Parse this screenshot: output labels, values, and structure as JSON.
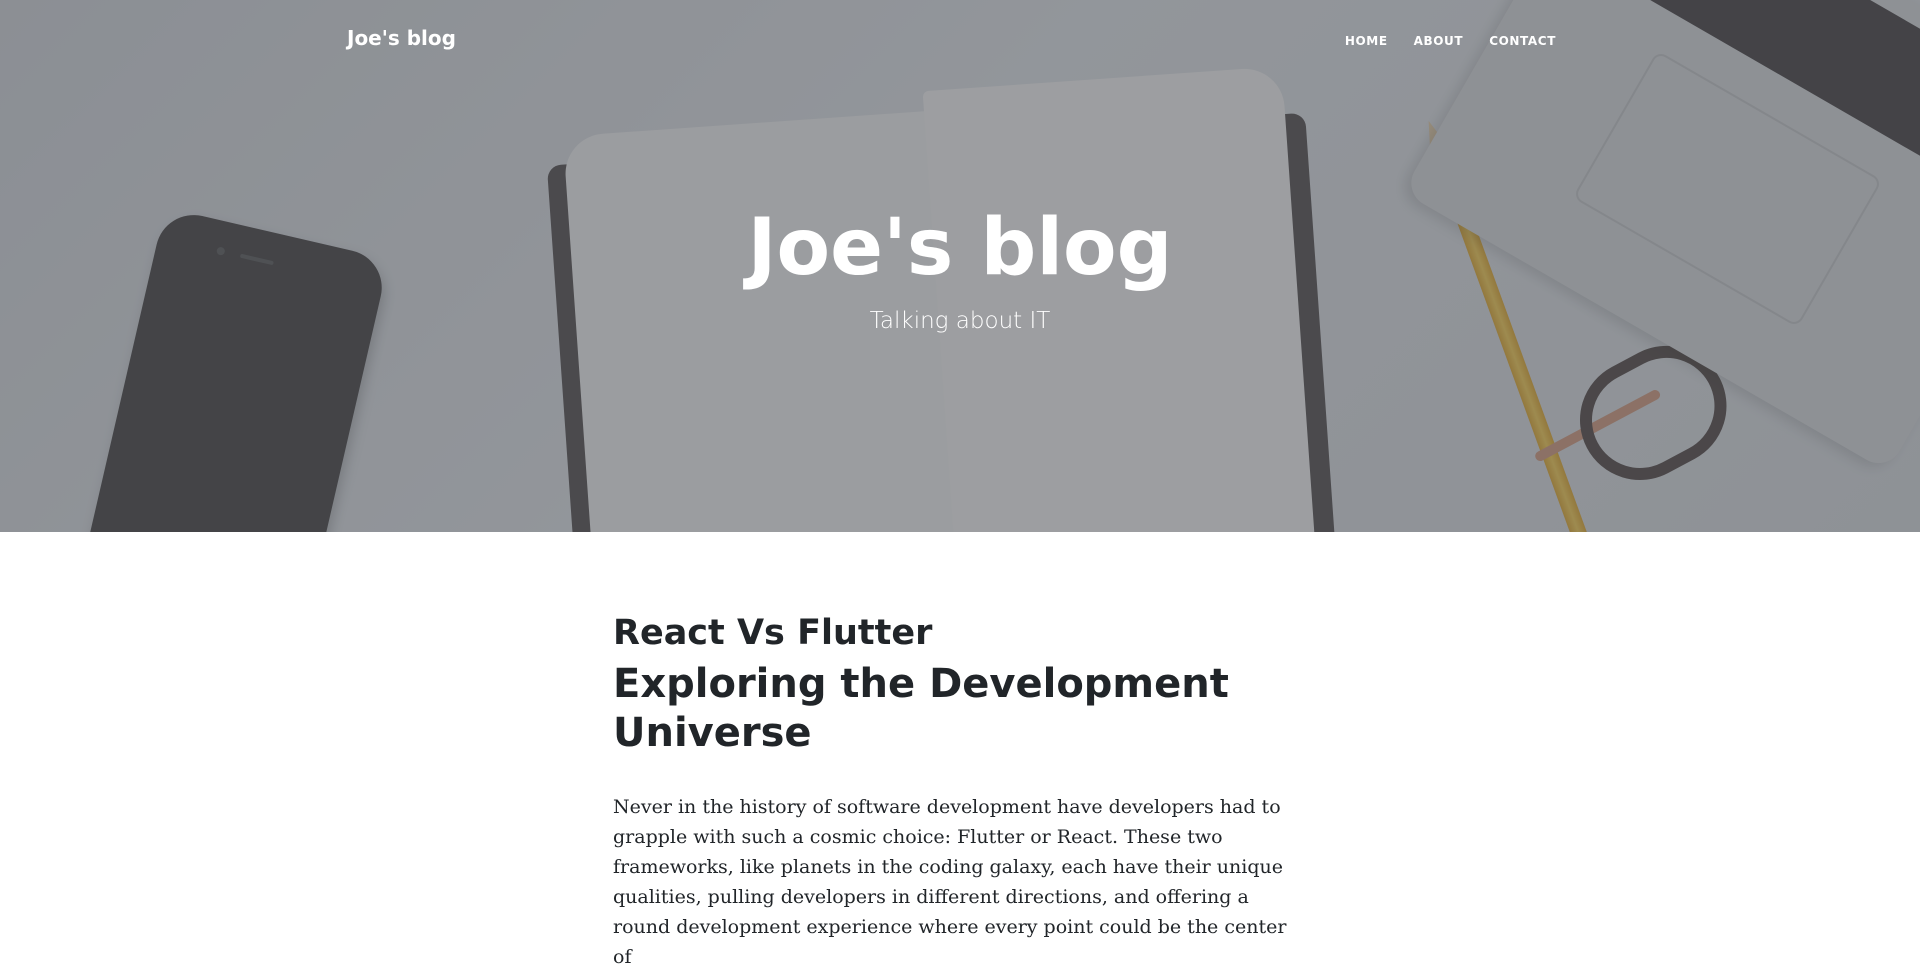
{
  "nav": {
    "brand": "Joe's blog",
    "links": [
      {
        "label": "HOME"
      },
      {
        "label": "ABOUT"
      },
      {
        "label": "CONTACT"
      }
    ]
  },
  "header": {
    "title": "Joe's blog",
    "subtitle": "Talking about IT"
  },
  "post": {
    "title": "React Vs Flutter",
    "subtitle": "Exploring the Development Universe",
    "body": "Never in the history of software development have developers had to grapple with such a cosmic choice: Flutter or React. These two frameworks, like planets in the coding galaxy, each have their unique qualities, pulling developers in different directions, and offering a round development experience where every point could be the center of"
  },
  "colors": {
    "overlay": "#5a5c62",
    "text_dark": "#212529",
    "text_light": "#ffffff"
  }
}
